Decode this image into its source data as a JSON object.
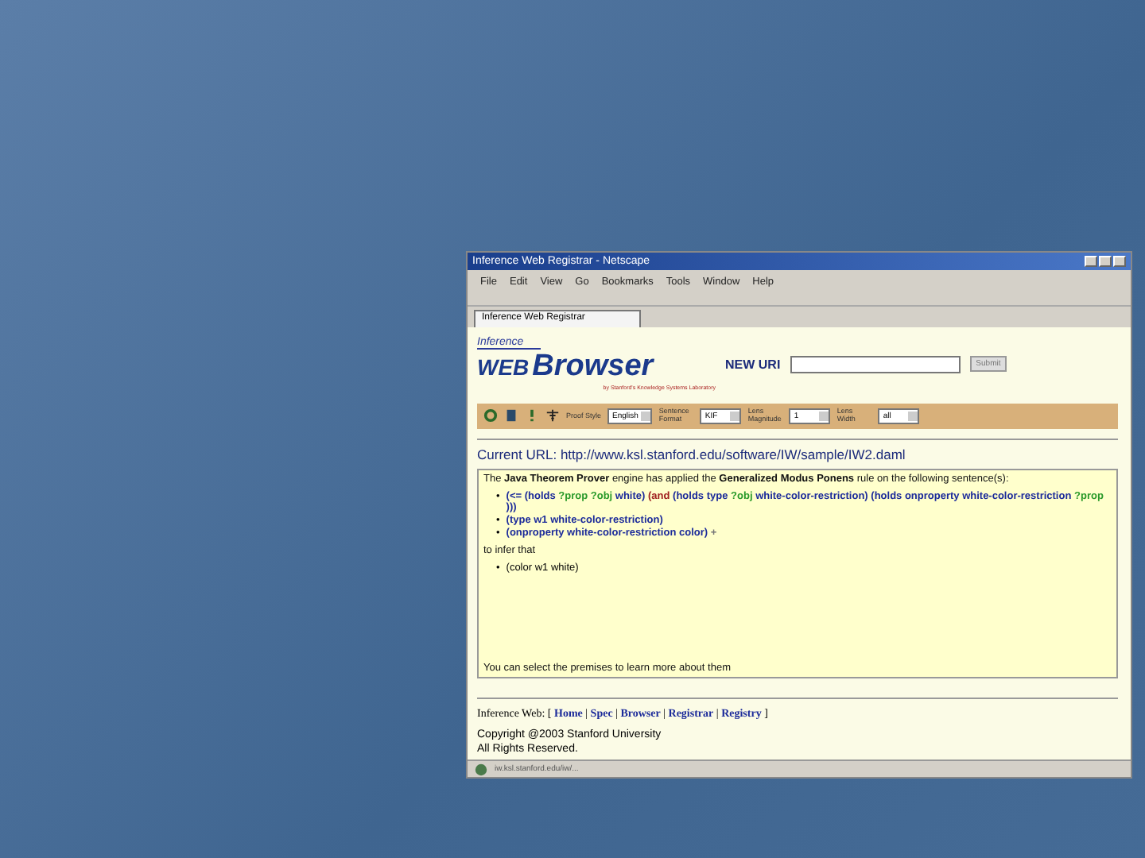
{
  "window": {
    "title": "Inference Web Registrar - Netscape"
  },
  "menu": [
    "File",
    "Edit",
    "View",
    "Go",
    "Bookmarks",
    "Tools",
    "Window",
    "Help"
  ],
  "tabs": [
    {
      "label": "Inference Web Registrar",
      "selected": true
    }
  ],
  "logo": {
    "top": "Inference",
    "left": "WEB",
    "right": "Browser",
    "tagline": "by Stanford's Knowledge Systems Laboratory"
  },
  "new_uri": {
    "label": "NEW URI",
    "button": "Submit"
  },
  "options": [
    {
      "label": "Proof Style",
      "value": "English"
    },
    {
      "label": "Sentence Format",
      "value": "KIF"
    },
    {
      "label": "Lens Magnitude",
      "value": "1"
    },
    {
      "label": "Lens Width",
      "value": "all"
    }
  ],
  "current_url": {
    "label": "Current URL:",
    "value": "http://www.ksl.stanford.edu/software/IW/sample/IW2.daml"
  },
  "explanation": {
    "bullet": "•",
    "intro": "The **Java Theorem Prover** engine has applied the **Generalized Modus Ponens** rule on the following sentence(s):",
    "premises": [
      [
        {
          "kind": "term",
          "text": "(<= (holds"
        },
        {
          "kind": "variable",
          "text": "?prop ?obj"
        },
        {
          "kind": "term",
          "text": "white)"
        },
        {
          "kind": "keyword",
          "text": "(and"
        },
        {
          "kind": "term",
          "text": "(holds type"
        },
        {
          "kind": "variable",
          "text": "?obj"
        },
        {
          "kind": "term",
          "text": "white-color-restriction) (holds onproperty white-color-restriction"
        },
        {
          "kind": "variable",
          "text": "?prop"
        },
        {
          "kind": "term",
          "text": ")))"
        }
      ],
      [
        {
          "kind": "term",
          "text": "(type w1 white-color-restriction)"
        }
      ],
      [
        {
          "kind": "term",
          "text": "(onproperty white-color-restriction color)"
        },
        {
          "kind": "marker",
          "text": "+"
        }
      ]
    ],
    "infer": "to infer that",
    "conclusions": [
      "(color w1 white)"
    ],
    "note": "You can select the premises to learn more about them"
  },
  "footer": {
    "label": "Inference Web:",
    "open": "[",
    "separator": "|",
    "close": "]",
    "links": [
      "Home",
      "Spec",
      "Browser",
      "Registrar",
      "Registry"
    ],
    "copyright": [
      "Copyright @2003 Stanford University",
      "All Rights Reserved."
    ]
  },
  "status_bar": {
    "text": "iw.ksl.stanford.edu/iw/..."
  }
}
